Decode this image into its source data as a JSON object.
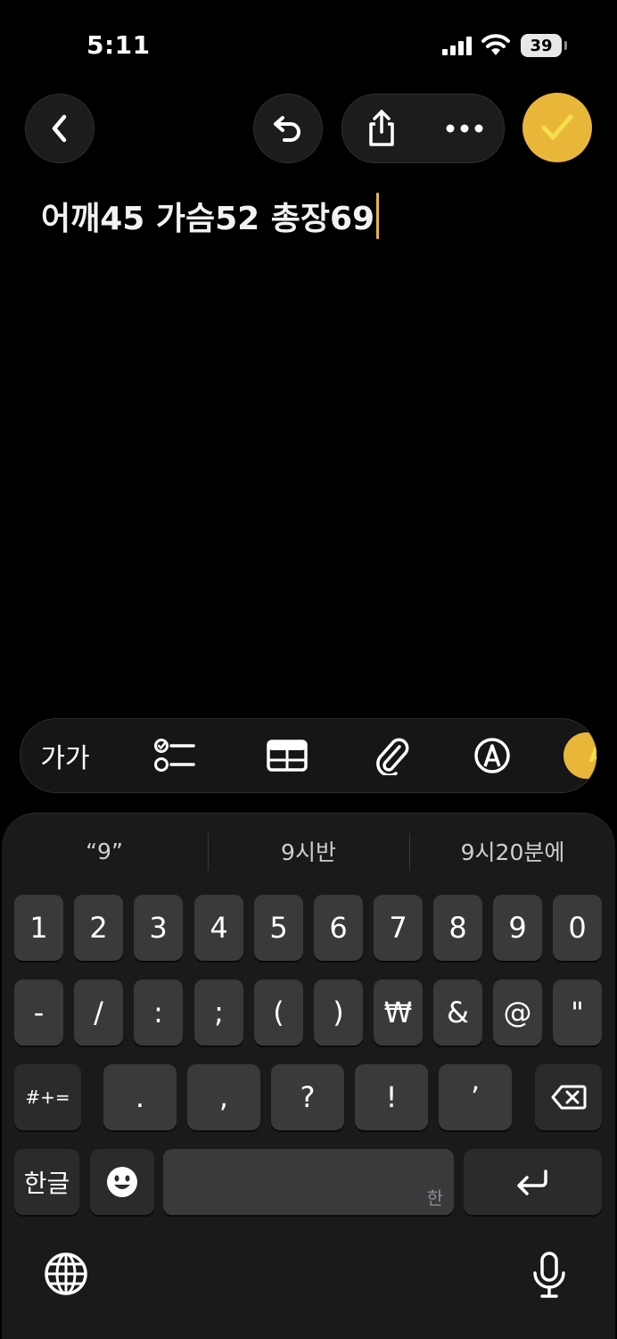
{
  "status_bar": {
    "time": "5:11",
    "battery": "39"
  },
  "note": {
    "text": "어깨45 가슴52 총장69"
  },
  "format_bar": {
    "text_style_label": "가가"
  },
  "suggestions": [
    "“9”",
    "9시반",
    "9시20분에"
  ],
  "keyboard": {
    "row1": [
      "1",
      "2",
      "3",
      "4",
      "5",
      "6",
      "7",
      "8",
      "9",
      "0"
    ],
    "row2": [
      "-",
      "/",
      ":",
      ";",
      "(",
      ")",
      "₩",
      "&",
      "@",
      "\""
    ],
    "row3": [
      ".",
      ",",
      "?",
      "!",
      "’"
    ],
    "symbols_label": "#+=",
    "lang_label": "한글",
    "space_hint": "한"
  },
  "colors": {
    "accent": "#e8b73a",
    "background": "#000000",
    "key": "#3a3a3c"
  }
}
